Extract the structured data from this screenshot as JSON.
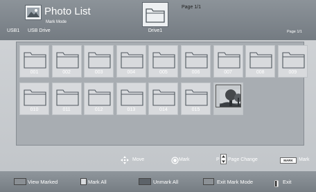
{
  "header": {
    "title": "Photo List",
    "mode": "Mark Mode",
    "source": "USB1",
    "device": "USB Drive",
    "current_folder": "Drive1",
    "page_top": "Page 1/1",
    "page_right": "Page 1/1"
  },
  "files": [
    {
      "label": "001",
      "type": "folder"
    },
    {
      "label": "002",
      "type": "folder"
    },
    {
      "label": "003",
      "type": "folder"
    },
    {
      "label": "004",
      "type": "folder"
    },
    {
      "label": "005",
      "type": "folder"
    },
    {
      "label": "006",
      "type": "folder"
    },
    {
      "label": "007",
      "type": "folder"
    },
    {
      "label": "008",
      "type": "folder"
    },
    {
      "label": "009",
      "type": "folder"
    },
    {
      "label": "010",
      "type": "folder"
    },
    {
      "label": "011",
      "type": "folder"
    },
    {
      "label": "012",
      "type": "folder"
    },
    {
      "label": "013",
      "type": "folder"
    },
    {
      "label": "014",
      "type": "folder"
    },
    {
      "label": "015",
      "type": "folder"
    },
    {
      "label": "",
      "type": "photo"
    }
  ],
  "help": {
    "move": "Move",
    "mark": "Mark",
    "page_key": "P",
    "page_change": "Page Change",
    "mark_key": "MARK",
    "mark_key_label": "Mark"
  },
  "buttons": {
    "view_marked": "View Marked",
    "mark_all": "Mark All",
    "unmark_all": "Unmark All",
    "exit_mark_mode": "Exit Mark Mode",
    "exit": "Exit"
  },
  "colors": {
    "red_key": "#8a8f94",
    "green_key": "#d9dcdf",
    "yellow_key": "#5d6369",
    "blue_key": "#8c9196"
  },
  "icons": {
    "app": "photo-list-icon",
    "folder": "folder-icon",
    "move": "arrows-icon",
    "mark": "ok-button-icon",
    "page": "page-updown-icon",
    "exit": "back-icon"
  }
}
